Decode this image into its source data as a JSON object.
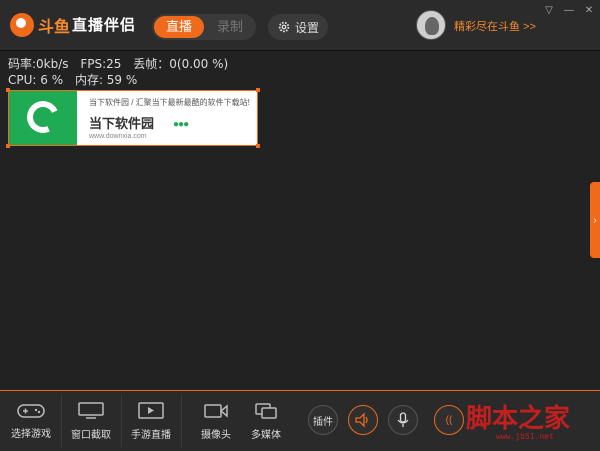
{
  "app": {
    "logo_text": "斗鱼",
    "name": "直播伴侣"
  },
  "mode": {
    "live_label": "直播",
    "record_label": "录制"
  },
  "settings": {
    "label": "设置"
  },
  "promo": {
    "text": "精彩尽在斗鱼 >>"
  },
  "window_controls": {
    "menu": "▽",
    "minimize": "—",
    "close": "✕"
  },
  "stats": {
    "bitrate": "码率:0kb/s",
    "fps": "FPS:25",
    "dropped": "丢帧：0(0.00 %)",
    "cpu": "CPU: 6 %",
    "memory": "内存: 59 %"
  },
  "preview": {
    "line1": "当下软件园 / 汇聚当下最新最酷的软件下载站!",
    "title": "当下软件园",
    "url": "www.downxia.com"
  },
  "toolbar": {
    "items": [
      {
        "label": "选择游戏",
        "icon": "gamepad-icon"
      },
      {
        "label": "窗口截取",
        "icon": "monitor-icon"
      },
      {
        "label": "手游直播",
        "icon": "play-icon"
      },
      {
        "label": "摄像头",
        "icon": "camera-icon"
      },
      {
        "label": "多媒体",
        "icon": "media-icon"
      }
    ],
    "plugin_label": "插件",
    "speaker_icon": "speaker-icon",
    "mic_icon": "microphone-icon"
  },
  "watermark": {
    "text": "脚本之家",
    "url": "www.jb51.net"
  },
  "colors": {
    "accent": "#f06a1b",
    "background": "#222222",
    "watermark": "#c21f1f"
  }
}
